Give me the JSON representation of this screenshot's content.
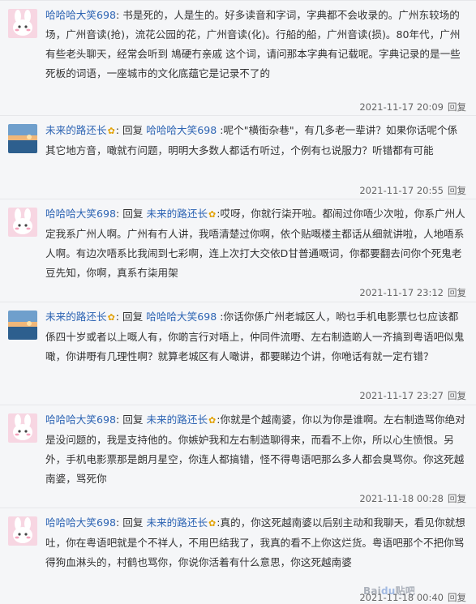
{
  "reply_button_label": "回复",
  "reply_prefix": "回复",
  "watermark": {
    "text": "Bai",
    "paw": "du",
    "suffix": "贴吧"
  },
  "colors": {
    "username": "#2d64b3",
    "background": "#f5f6f8"
  },
  "replies": [
    {
      "avatar": "pink-bunny-avatar",
      "author": "哈哈哈大笑698",
      "reply_to": "",
      "body": "书是死的，人是生的。好多读音和字词，字典都不会收录的。广州东较场的场，广州音读(抢)，流花公园的花，广州音读(化)。行船的船，广州音读(损)。80年代，广州有些老头聊天，经常会听到 鳩硬冇亲戚 这个词，请问那本字典有记载呢。字典记录的是一些死板的词语，一座城市的文化底蕴它是记录不了的",
      "time": "2021-11-17 20:09"
    },
    {
      "avatar": "sunset-landscape-avatar",
      "author": "未来的路还长",
      "reply_to": "哈哈哈大笑698",
      "body": "呢个\"横街杂巷\"，有几多老一辈讲？如果你话呢个係其它地方音，噉就冇问题，明明大多数人都话冇听过，个例有乜说服力？听错都有可能",
      "time": "2021-11-17 20:55"
    },
    {
      "avatar": "pink-bunny-avatar",
      "author": "哈哈哈大笑698",
      "reply_to": "未来的路还长",
      "body": "哎呀，你就行柒开啦。都闹过你唔少次啦，你系广州人定我系广州人啊。广州有冇人讲，我唔清楚过你啊，依个贴嘅楼主都话从细就讲啦，人地唔系人啊。有边次唔系比我闹到七彩啊，连上次打大交依D甘普通嘅词，你都要翻去问你个死鬼老豆先知，你啊，真系冇柒用架",
      "time": "2021-11-17 23:12"
    },
    {
      "avatar": "sunset-landscape-avatar",
      "author": "未来的路还长",
      "reply_to": "哈哈哈大笑698",
      "body": "你话你係广州老城区人，哟乜手机电影票乜乜应该都係四十岁或者以上嘅人有，你啲言行对唔上，仲同件流嘢、左右制造啲人一齐搞到粤语吧似鬼噉，你讲嘢有几理性啊？就算老城区有人噉讲，都要睇边个讲，你咃话有就一定冇错？",
      "time": "2021-11-17 23:27"
    },
    {
      "avatar": "pink-bunny-avatar",
      "author": "哈哈哈大笑698",
      "reply_to": "未来的路还长",
      "body": "你就是个越南婆，你以为你是谁啊。左右制造骂你绝对是没问题的，我是支持他的。你嫉妒我和左右制造聊得来，而看不上你，所以心生愤恨。另外，手机电影票那是朗月星空，你连人都搞错，怪不得粤语吧那么多人都会臭骂你。你这死越南婆，骂死你",
      "time": "2021-11-18 00:28"
    },
    {
      "avatar": "pink-bunny-avatar",
      "author": "哈哈哈大笑698",
      "reply_to": "未来的路还长",
      "body": "真的，你这死越南婆以后别主动和我聊天，看见你就想吐，你在粤语吧就是个不祥人，不用巴结我了，我真的看不上你这烂货。粤语吧那个不把你骂得狗血淋头的，村鹤也骂你，你说你活着有什么意思，你这死越南婆",
      "time": "2021-11-18 00:40"
    }
  ]
}
